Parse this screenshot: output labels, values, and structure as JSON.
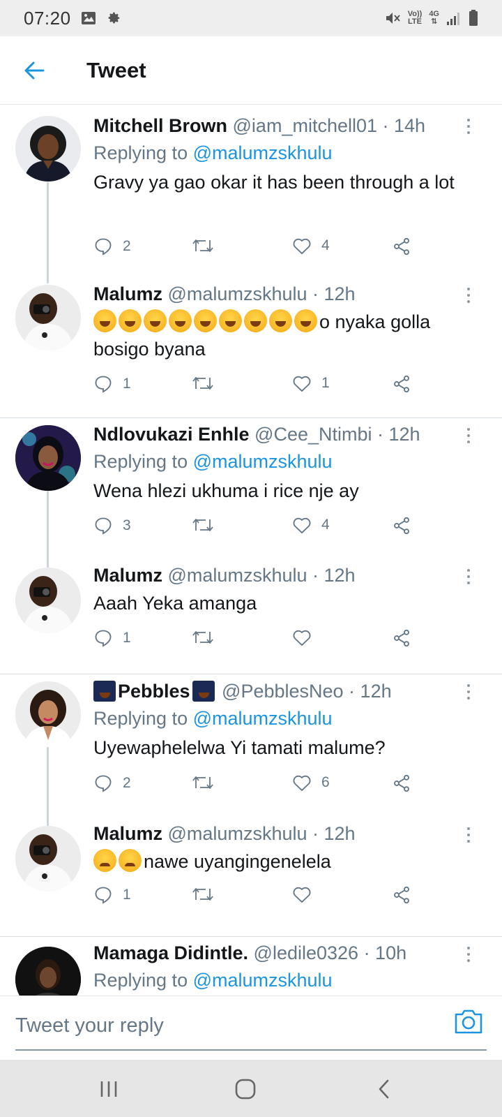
{
  "status_bar": {
    "time": "07:20",
    "volte_top": "Vo))",
    "volte_bottom": "LTE",
    "network": "4G",
    "icons": [
      "image-icon",
      "settings-gear-icon",
      "mute-icon",
      "signal-icon",
      "battery-icon"
    ]
  },
  "header": {
    "title": "Tweet",
    "back_icon": "back-arrow-icon"
  },
  "colors": {
    "accent": "#1b95e0",
    "text": "#14171a",
    "secondary": "#657786",
    "divider": "#d6dde3"
  },
  "tweets": [
    {
      "name": "Mitchell Brown",
      "meta": " @iam_mitchell01 · 14h",
      "replying_prefix": "Replying to ",
      "replying_handle": "@malumzskhulu",
      "text": "Gravy ya gao okar it has been through a lot",
      "replies": "2",
      "likes": "4"
    },
    {
      "name": "Malumz",
      "meta": " @malumzskhulu · 12h",
      "text_line1": "o nyaka golla",
      "text_line2": "bosigo byana",
      "emoji_count": 9,
      "replies": "1",
      "likes": "1"
    },
    {
      "name": "Ndlovukazi Enhle",
      "meta": " @Cee_Ntimbi · 12h",
      "replying_prefix": "Replying to ",
      "replying_handle": "@malumzskhulu",
      "text": "Wena hlezi ukhuma i rice nje ay",
      "replies": "3",
      "likes": "4"
    },
    {
      "name": "Malumz",
      "meta": " @malumzskhulu · 12h",
      "text": "Aaah Yeka amanga",
      "replies": "1",
      "likes": ""
    },
    {
      "name": "Pebbles",
      "meta": " @PebblesNeo · 12h",
      "replying_prefix": "Replying to ",
      "replying_handle": "@malumzskhulu",
      "text": "Uyewaphelelwa Yi tamati malume?",
      "replies": "2",
      "likes": "6"
    },
    {
      "name": "Malumz",
      "meta": " @malumzskhulu · 12h",
      "text": "nawe uyangingenelela",
      "emoji_count": 2,
      "replies": "1",
      "likes": ""
    },
    {
      "name": "Mamaga Didintle.",
      "meta": " @ledile0326 · 10h",
      "replying_prefix": "Replying to ",
      "replying_handle": "@malumzskhulu"
    }
  ],
  "composer": {
    "placeholder": "Tweet your reply",
    "camera_icon": "camera-icon"
  },
  "nav": {
    "icons": [
      "recent-apps-icon",
      "home-icon",
      "back-icon"
    ]
  }
}
